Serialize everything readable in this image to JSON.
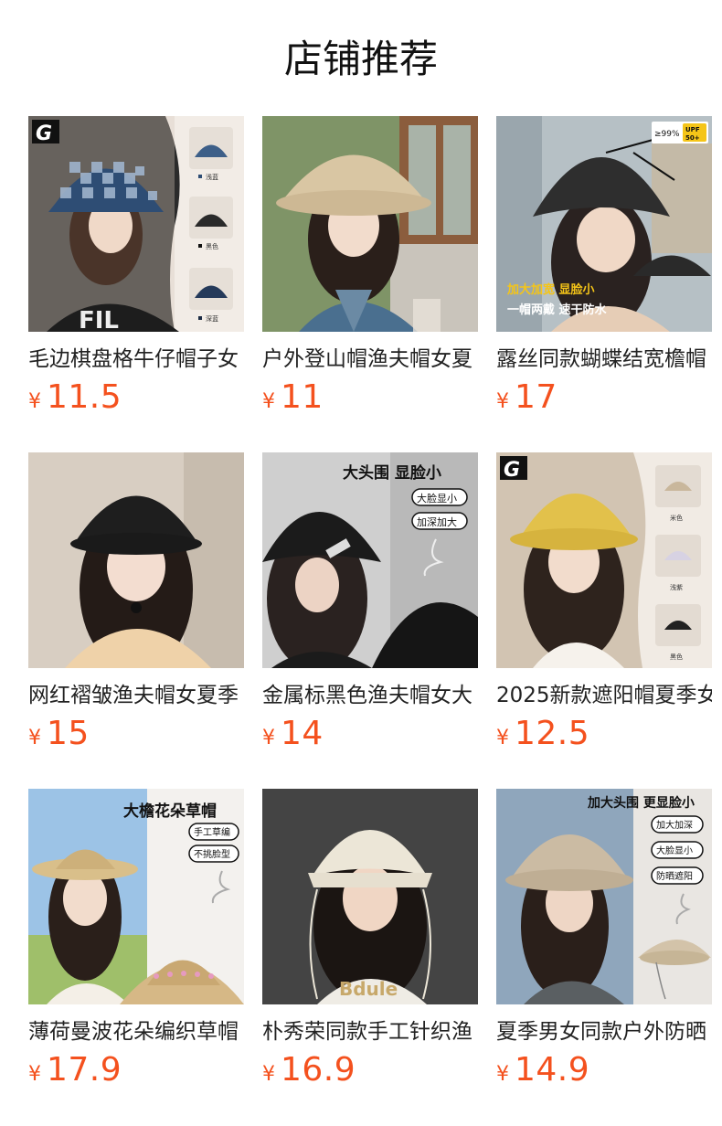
{
  "page": {
    "title": "店铺推荐"
  },
  "products": [
    {
      "title": "毛边棋盘格牛仔帽子女",
      "currency": "¥",
      "price": "11.5",
      "image": {
        "logo": "G",
        "swatch_labels": [
          "浅蓝",
          "黑色",
          "深蓝"
        ],
        "bg": "#f2ece6"
      }
    },
    {
      "title": "户外登山帽渔夫帽女夏",
      "currency": "¥",
      "price": "11",
      "image": {
        "bg": "#8a9b73"
      }
    },
    {
      "title": "露丝同款蝴蝶结宽檐帽",
      "currency": "¥",
      "price": "17",
      "image": {
        "badge_top": "≥99%",
        "badge_upf": "UPF",
        "badge_upf_val": "50+",
        "line1": "加大加宽 显脸小",
        "line2": "一帽两戴 速干防水",
        "bg": "#b9c3c8"
      }
    },
    {
      "title": "网红褶皱渔夫帽女夏季",
      "currency": "¥",
      "price": "15",
      "image": {
        "bg": "#d9cfc3"
      }
    },
    {
      "title": "金属标黑色渔夫帽女大",
      "currency": "¥",
      "price": "14",
      "image": {
        "headline": "大头围 显脸小",
        "pill1": "大脸显小",
        "pill2": "加深加大",
        "bg": "#c9c9c9"
      }
    },
    {
      "title": "2025新款遮阳帽夏季女",
      "currency": "¥",
      "price": "12.5",
      "image": {
        "logo": "G",
        "swatch_labels": [
          "米色",
          "浅紫",
          "黑色"
        ],
        "bg": "#f1ebe4"
      }
    },
    {
      "title": "薄荷曼波花朵编织草帽",
      "currency": "¥",
      "price": "17.9",
      "image": {
        "headline": "大檐花朵草帽",
        "pill1": "手工草编",
        "pill2": "不挑脸型",
        "bg": "#f3f1ee"
      }
    },
    {
      "title": "朴秀荣同款手工针织渔",
      "currency": "¥",
      "price": "16.9",
      "image": {
        "shirt_text": "Bdule",
        "bg": "#3a3a3a"
      }
    },
    {
      "title": "夏季男女同款户外防晒",
      "currency": "¥",
      "price": "14.9",
      "image": {
        "headline": "加大头围 更显脸小",
        "pill1": "加大加深",
        "pill2": "大脸显小",
        "pill3": "防晒遮阳",
        "bg": "#e9e6e2"
      }
    }
  ]
}
